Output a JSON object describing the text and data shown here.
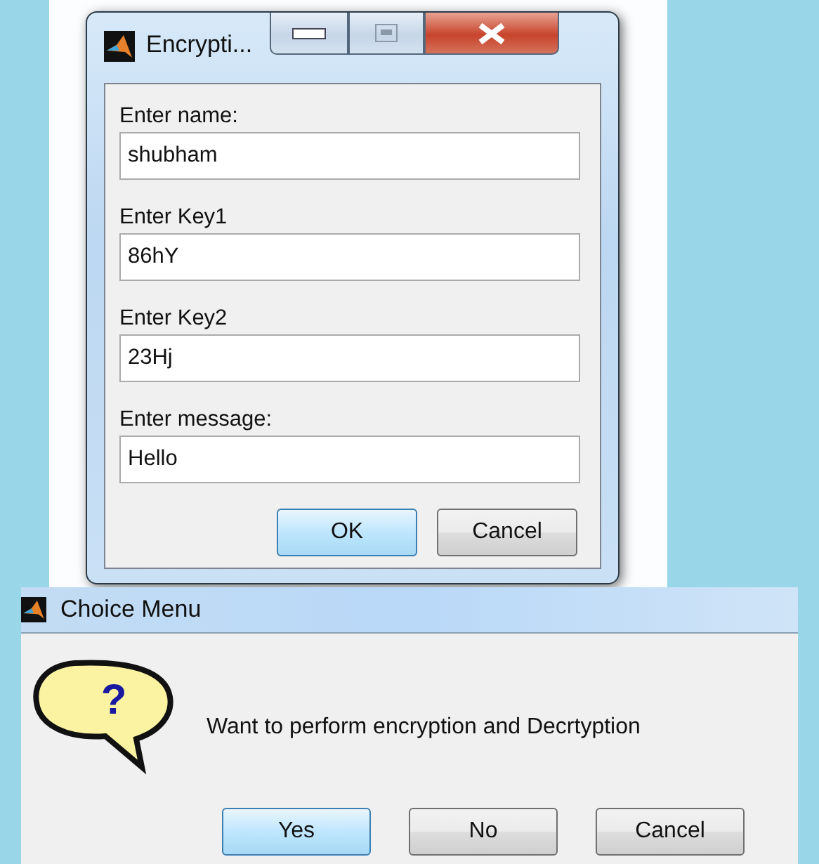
{
  "input_dialog": {
    "title": "Encrypti...",
    "fields": [
      {
        "label": "Enter name:",
        "value": "shubham"
      },
      {
        "label": "Enter Key1",
        "value": "86hY"
      },
      {
        "label": "Enter Key2",
        "value": "23Hj"
      },
      {
        "label": "Enter message:",
        "value": "Hello"
      }
    ],
    "buttons": [
      {
        "label": "OK",
        "default": true
      },
      {
        "label": "Cancel",
        "default": false
      }
    ]
  },
  "choice_dialog": {
    "title": "Choice Menu",
    "icon_glyph": "?",
    "message": "Want to perform encryption and Decrtyption",
    "buttons": [
      {
        "label": "Yes",
        "default": true
      },
      {
        "label": "No",
        "default": false
      },
      {
        "label": "Cancel",
        "default": false
      }
    ]
  }
}
